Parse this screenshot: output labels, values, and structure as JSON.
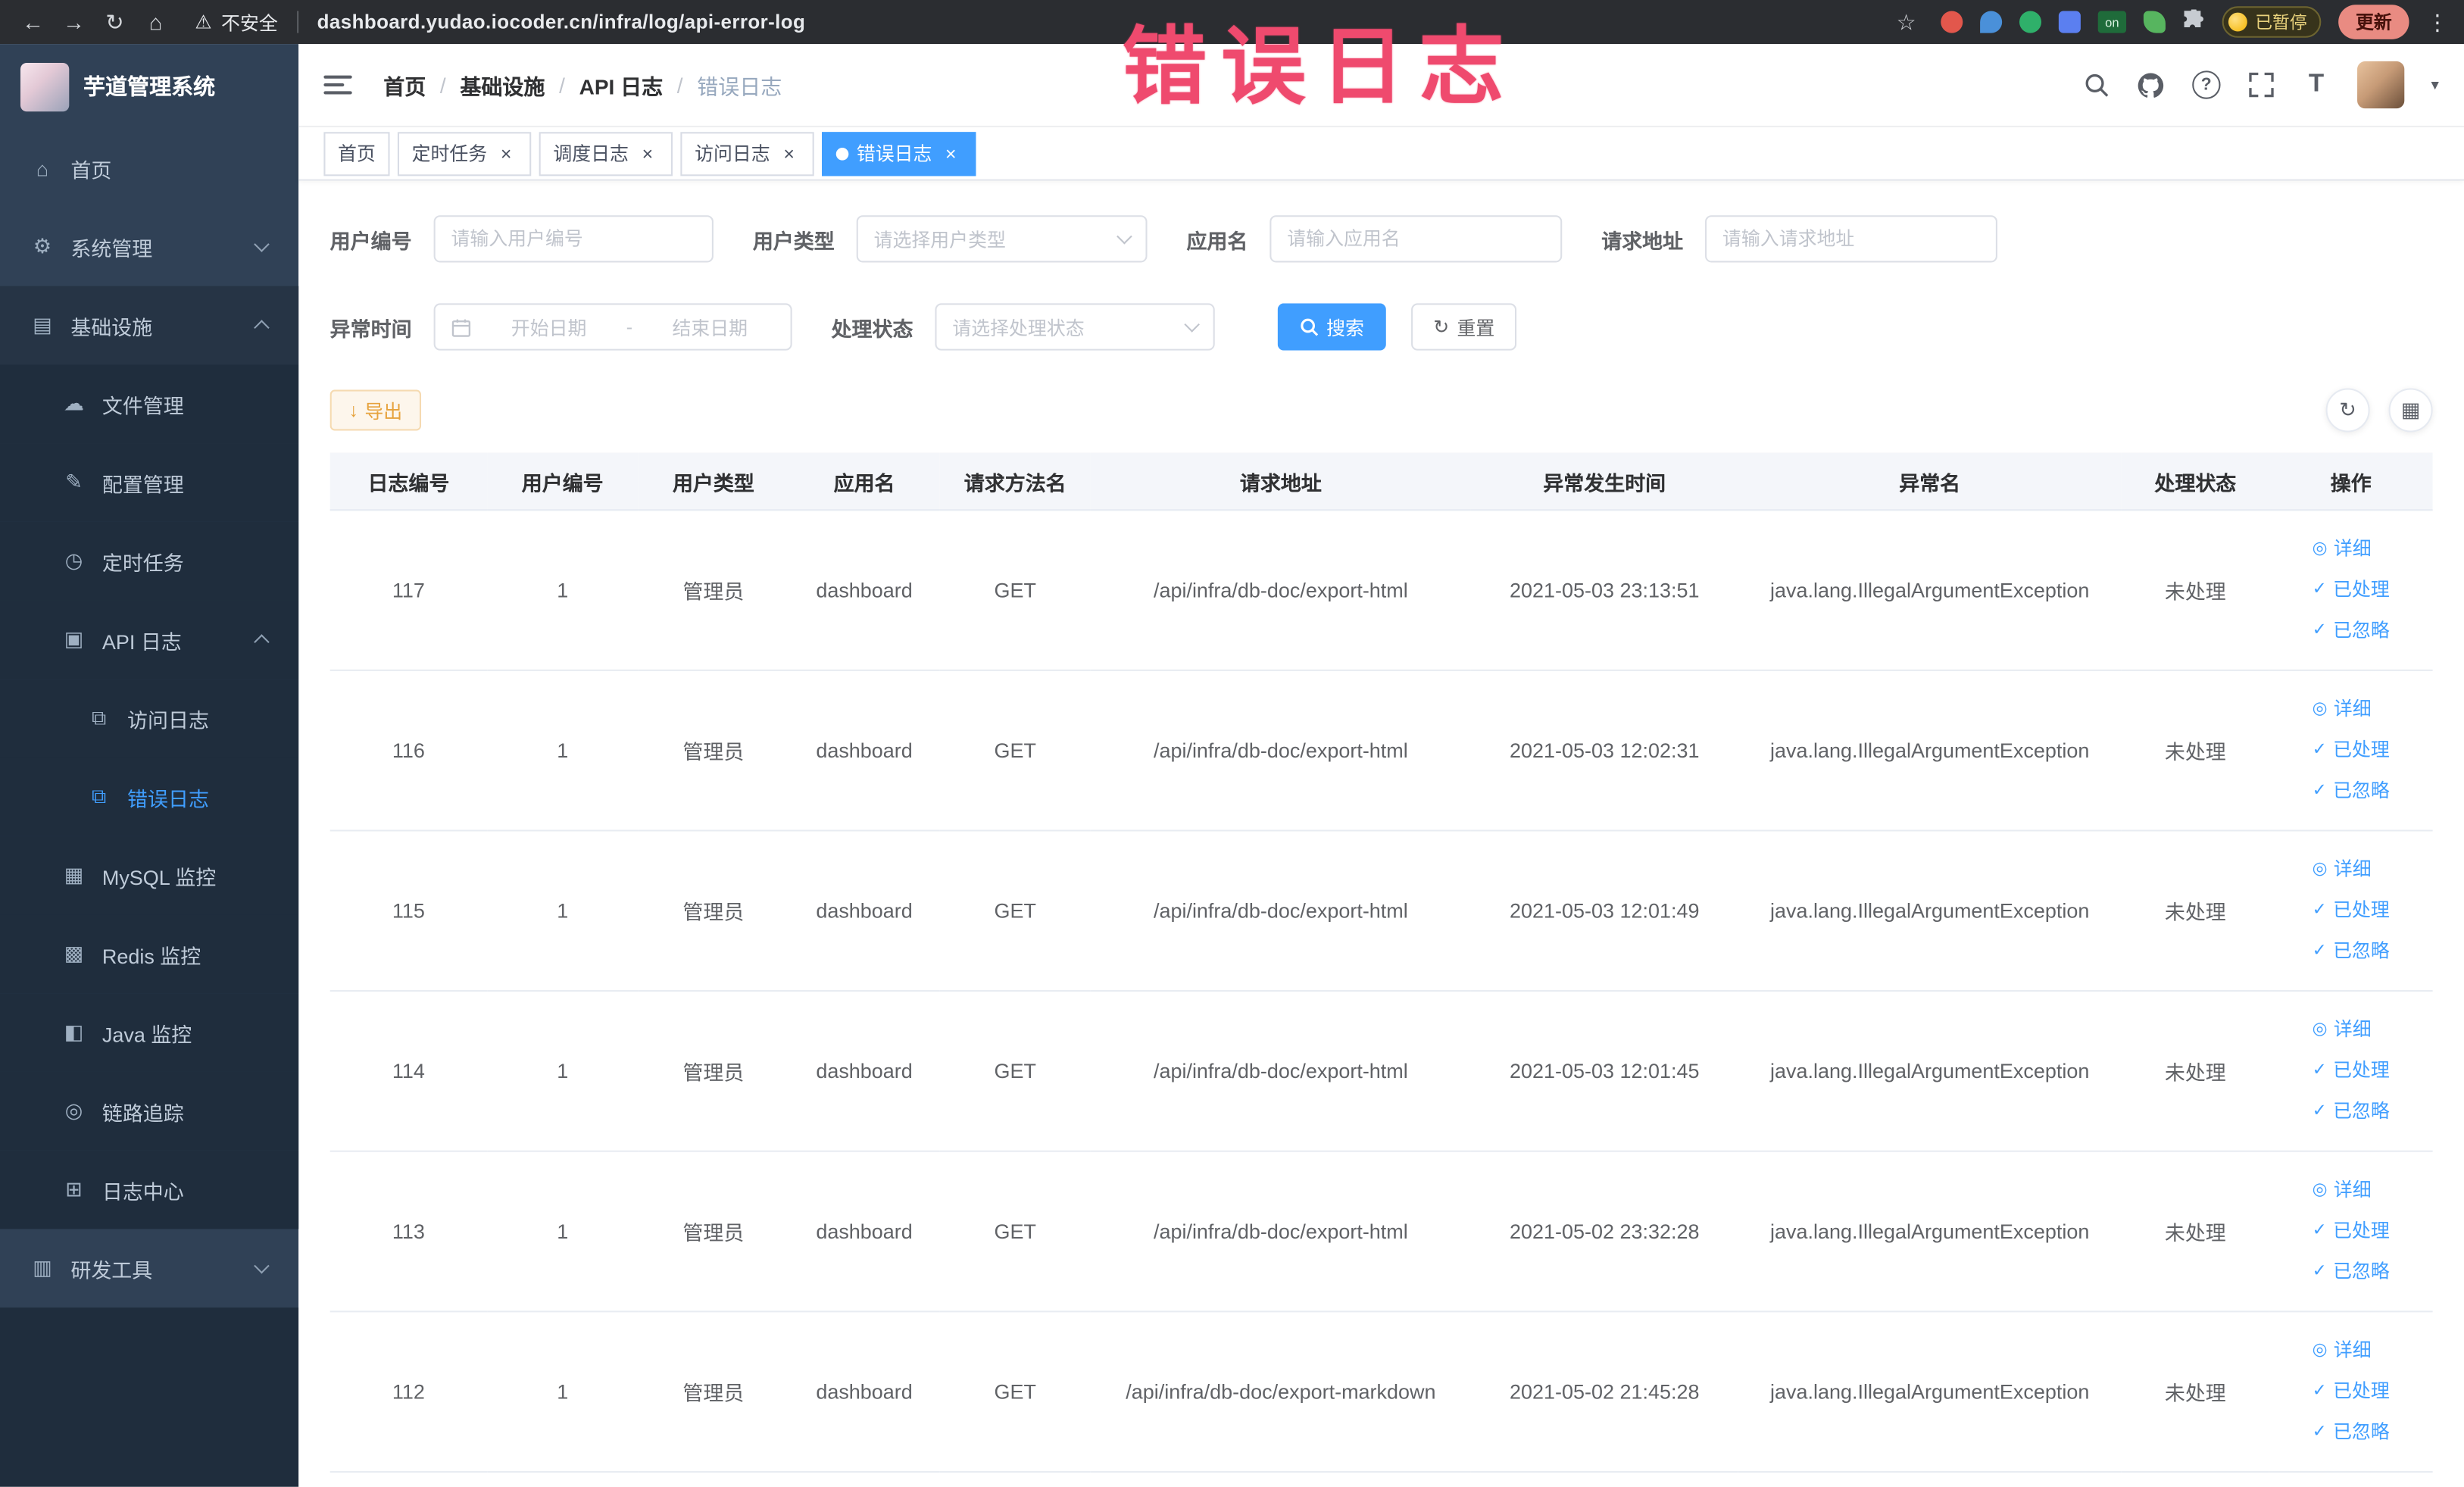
{
  "browser": {
    "security_label": "不安全",
    "url": "dashboard.yudao.iocoder.cn/infra/log/api-error-log",
    "extension_on_label": "on",
    "paused_badge": "已暂停",
    "update_button": "更新"
  },
  "annotation": {
    "text": "错误日志"
  },
  "sidebar": {
    "logo_title": "芋道管理系统",
    "items": [
      {
        "label": "首页"
      },
      {
        "label": "系统管理"
      },
      {
        "label": "基础设施"
      },
      {
        "label": "文件管理"
      },
      {
        "label": "配置管理"
      },
      {
        "label": "定时任务"
      },
      {
        "label": "API 日志"
      },
      {
        "label": "访问日志"
      },
      {
        "label": "错误日志"
      },
      {
        "label": "MySQL 监控"
      },
      {
        "label": "Redis 监控"
      },
      {
        "label": "Java 监控"
      },
      {
        "label": "链路追踪"
      },
      {
        "label": "日志中心"
      },
      {
        "label": "研发工具"
      }
    ]
  },
  "header": {
    "breadcrumb": [
      "首页",
      "基础设施",
      "API 日志",
      "错误日志"
    ],
    "breadcrumb_separator": "/"
  },
  "tabs": [
    {
      "label": "首页"
    },
    {
      "label": "定时任务"
    },
    {
      "label": "调度日志"
    },
    {
      "label": "访问日志"
    },
    {
      "label": "错误日志"
    }
  ],
  "filters": {
    "user_id": {
      "label": "用户编号",
      "placeholder": "请输入用户编号"
    },
    "user_type": {
      "label": "用户类型",
      "placeholder": "请选择用户类型"
    },
    "app_name": {
      "label": "应用名",
      "placeholder": "请输入应用名"
    },
    "request_url": {
      "label": "请求地址",
      "placeholder": "请输入请求地址"
    },
    "exception_time": {
      "label": "异常时间",
      "start_placeholder": "开始日期",
      "separator": "-",
      "end_placeholder": "结束日期"
    },
    "process_status": {
      "label": "处理状态",
      "placeholder": "请选择处理状态"
    },
    "search_button": "搜索",
    "reset_button": "重置"
  },
  "toolbar": {
    "export_button": "导出"
  },
  "table": {
    "columns": [
      "日志编号",
      "用户编号",
      "用户类型",
      "应用名",
      "请求方法名",
      "请求地址",
      "异常发生时间",
      "异常名",
      "处理状态",
      "操作"
    ],
    "action_labels": [
      "详细",
      "已处理",
      "已忽略"
    ],
    "rows": [
      {
        "id": "117",
        "user_id": "1",
        "user_type": "管理员",
        "app": "dashboard",
        "method": "GET",
        "url": "/api/infra/db-doc/export-html",
        "time": "2021-05-03 23:13:51",
        "exception": "java.lang.IllegalArgumentException",
        "status": "未处理"
      },
      {
        "id": "116",
        "user_id": "1",
        "user_type": "管理员",
        "app": "dashboard",
        "method": "GET",
        "url": "/api/infra/db-doc/export-html",
        "time": "2021-05-03 12:02:31",
        "exception": "java.lang.IllegalArgumentException",
        "status": "未处理"
      },
      {
        "id": "115",
        "user_id": "1",
        "user_type": "管理员",
        "app": "dashboard",
        "method": "GET",
        "url": "/api/infra/db-doc/export-html",
        "time": "2021-05-03 12:01:49",
        "exception": "java.lang.IllegalArgumentException",
        "status": "未处理"
      },
      {
        "id": "114",
        "user_id": "1",
        "user_type": "管理员",
        "app": "dashboard",
        "method": "GET",
        "url": "/api/infra/db-doc/export-html",
        "time": "2021-05-03 12:01:45",
        "exception": "java.lang.IllegalArgumentException",
        "status": "未处理"
      },
      {
        "id": "113",
        "user_id": "1",
        "user_type": "管理员",
        "app": "dashboard",
        "method": "GET",
        "url": "/api/infra/db-doc/export-html",
        "time": "2021-05-02 23:32:28",
        "exception": "java.lang.IllegalArgumentException",
        "status": "未处理"
      },
      {
        "id": "112",
        "user_id": "1",
        "user_type": "管理员",
        "app": "dashboard",
        "method": "GET",
        "url": "/api/infra/db-doc/export-markdown",
        "time": "2021-05-02 21:45:28",
        "exception": "java.lang.IllegalArgumentException",
        "status": "未处理"
      }
    ]
  },
  "icons": {
    "home": "⌂",
    "gear": "⚙",
    "infra": "▤",
    "file": "☁",
    "config": "✎",
    "timer": "◷",
    "api_log": "▣",
    "access_log": "⧉",
    "error_log": "⧉",
    "mysql": "▦",
    "redis": "▩",
    "java": "◧",
    "trace": "◎",
    "log_center": "⊞",
    "tools": "▥",
    "back": "←",
    "forward": "→",
    "reload": "↻",
    "browser_home": "⌂",
    "warning": "⚠",
    "star": "☆",
    "dots": "⋮",
    "caret": "▾",
    "close": "×",
    "eye": "◎",
    "check": "✓",
    "download": "↓",
    "refresh": "↻",
    "grid": "▦",
    "question": "?",
    "font_size": "T"
  },
  "colors": {
    "accent": "#409eff",
    "warning": "#e6a23c",
    "annotation_pink": "#ef4a6e",
    "sidebar_bg": "#304156",
    "sidebar_sub_bg": "#1f2d3d"
  }
}
